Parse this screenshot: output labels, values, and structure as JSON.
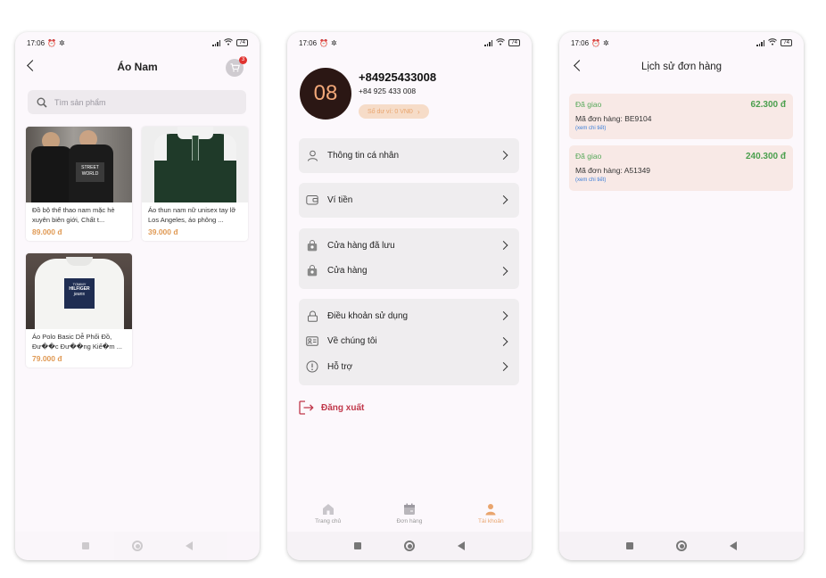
{
  "status": {
    "time": "17:06",
    "battery": "74"
  },
  "screen1": {
    "title": "Áo Nam",
    "cart_count": "3",
    "search_placeholder": "Tìm sản phẩm",
    "products": [
      {
        "name": "Đồ bộ thể thao nam mặc hè xuyên biên giới, Chất t...",
        "price": "89.000 đ"
      },
      {
        "name": "Áo thun nam nữ unisex tay lỡ Los Angeles, áo phông ...",
        "price": "39.000 đ"
      },
      {
        "name": "Áo Polo Basic Dễ Phối Đồ, Đư��c Đư��ng Kiể�m ...",
        "price": "79.000 đ"
      }
    ],
    "product_image_text": {
      "street": "STREET",
      "world": "WORLD",
      "tommy": "TOMMY",
      "hilfiger": "HILFIGER",
      "jeans": "jeans"
    }
  },
  "screen2": {
    "avatar_text": "08",
    "phone_main": "+84925433008",
    "phone_sub": "+84 925 433 008",
    "wallet_balance": "Số dư ví: 0 VNĐ",
    "groups": [
      [
        {
          "label": "Thông tin cá nhân",
          "icon": "user-icon"
        }
      ],
      [
        {
          "label": "Ví tiền",
          "icon": "wallet-icon"
        }
      ],
      [
        {
          "label": "Cửa hàng đã lưu",
          "icon": "bag-icon"
        },
        {
          "label": "Cửa hàng",
          "icon": "bag-icon"
        }
      ],
      [
        {
          "label": "Điều khoản sử dụng",
          "icon": "lock-icon"
        },
        {
          "label": "Về chúng tôi",
          "icon": "id-card-icon"
        },
        {
          "label": "Hỗ trợ",
          "icon": "info-icon"
        }
      ]
    ],
    "logout": "Đăng xuất",
    "tabs": [
      {
        "label": "Trang chủ",
        "icon": "home-icon"
      },
      {
        "label": "Đơn hàng",
        "icon": "calendar-icon"
      },
      {
        "label": "Tài khoản",
        "icon": "account-icon"
      }
    ],
    "accent": "#e9a56e"
  },
  "screen3": {
    "title": "Lịch sử đơn hàng",
    "orders": [
      {
        "status": "Đã giao",
        "amount": "62.300 đ",
        "code": "Mã đơn hàng: BE9104",
        "more": "(xem chi tiết)"
      },
      {
        "status": "Đã giao",
        "amount": "240.300 đ",
        "code": "Mã đơn hàng: A51349",
        "more": "(xem chi tiết)"
      }
    ]
  }
}
